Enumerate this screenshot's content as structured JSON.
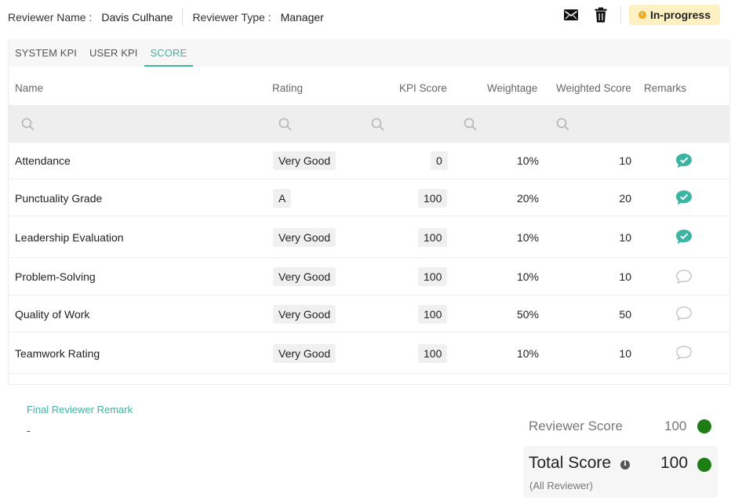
{
  "reviewer": {
    "name_label": "Reviewer Name :",
    "name": "Davis Culhane",
    "type_label": "Reviewer Type :",
    "type": "Manager"
  },
  "status": {
    "label": "In-progress",
    "color": "#f2a81d"
  },
  "actions": [
    {
      "name": "email-icon"
    },
    {
      "name": "trash-icon"
    }
  ],
  "tabs": [
    {
      "label": "SYSTEM KPI",
      "active": false
    },
    {
      "label": "USER KPI",
      "active": false
    },
    {
      "label": "SCORE",
      "active": true
    }
  ],
  "columns": {
    "name": "Name",
    "rating": "Rating",
    "kpi_score": "KPI Score",
    "weightage": "Weightage",
    "weighted_score": "Weighted Score",
    "remarks": "Remarks"
  },
  "rows": [
    {
      "name": "Attendance",
      "rating": "Very Good",
      "kpi_score": "0",
      "weightage": "10%",
      "weighted_score": "10",
      "remark": "filled"
    },
    {
      "name": "Punctuality Grade",
      "rating": "A",
      "kpi_score": "100",
      "weightage": "20%",
      "weighted_score": "20",
      "remark": "filled"
    },
    {
      "name": "Leadership Evaluation",
      "rating": "Very Good",
      "kpi_score": "100",
      "weightage": "10%",
      "weighted_score": "10",
      "remark": "filled"
    },
    {
      "name": "Problem-Solving",
      "rating": "Very Good",
      "kpi_score": "100",
      "weightage": "10%",
      "weighted_score": "10",
      "remark": "empty"
    },
    {
      "name": "Quality of Work",
      "rating": "Very Good",
      "kpi_score": "100",
      "weightage": "50%",
      "weighted_score": "50",
      "remark": "empty"
    },
    {
      "name": "Teamwork Rating",
      "rating": "Very Good",
      "kpi_score": "100",
      "weightage": "10%",
      "weighted_score": "10",
      "remark": "empty"
    }
  ],
  "final_remark": {
    "label": "Final Reviewer Remark",
    "value": "-"
  },
  "reviewer_score": {
    "label": "Reviewer Score",
    "value": "100"
  },
  "total_score": {
    "label": "Total Score",
    "value": "100",
    "sub": "(All Reviewer)"
  },
  "colors": {
    "accent": "#3bb5a1",
    "score_dot": "#1e7d14",
    "status_bg": "#fdf1c4"
  }
}
